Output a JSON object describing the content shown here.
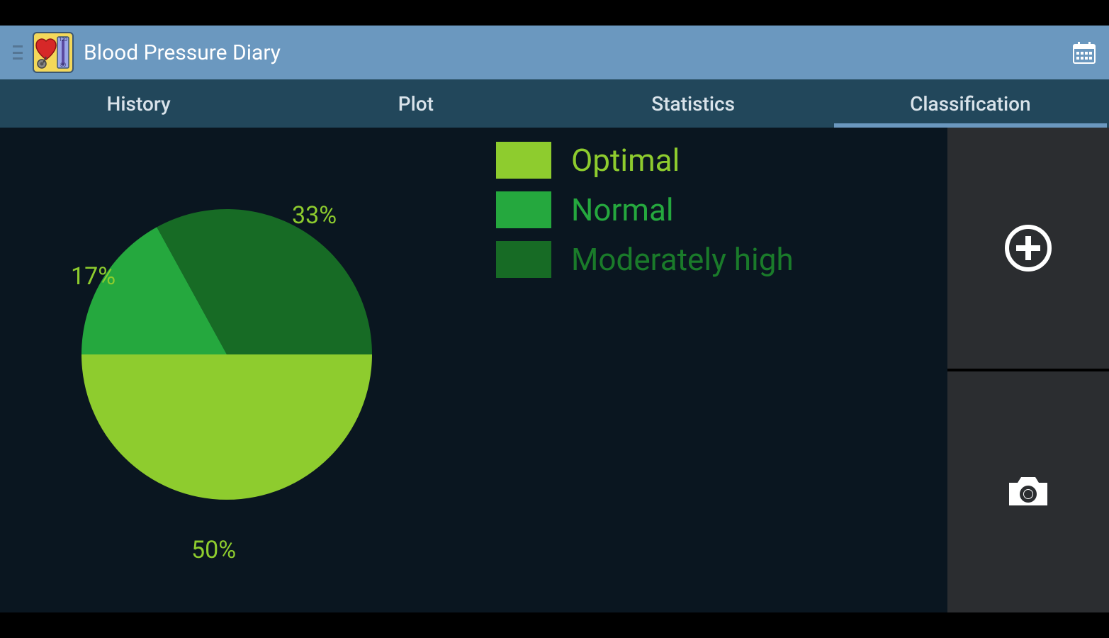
{
  "header": {
    "title": "Blood Pressure Diary",
    "logo_values": {
      "top": "120",
      "bottom": "80"
    }
  },
  "tabs": [
    {
      "label": "History"
    },
    {
      "label": "Plot"
    },
    {
      "label": "Statistics"
    },
    {
      "label": "Classification"
    }
  ],
  "active_tab_index": 3,
  "legend": {
    "items": [
      {
        "label": "Optimal",
        "color": "#8ecc2e"
      },
      {
        "label": "Normal",
        "color": "#25a83e"
      },
      {
        "label": "Moderately high",
        "color": "#176b25"
      }
    ]
  },
  "pie_labels": {
    "optimal": "50%",
    "normal": "17%",
    "modhigh": "33%"
  },
  "chart_data": {
    "type": "pie",
    "title": "Classification",
    "series": [
      {
        "name": "Optimal",
        "value": 50,
        "color": "#8ecc2e"
      },
      {
        "name": "Normal",
        "value": 17,
        "color": "#25a83e"
      },
      {
        "name": "Moderately high",
        "value": 33,
        "color": "#176b25"
      }
    ]
  }
}
